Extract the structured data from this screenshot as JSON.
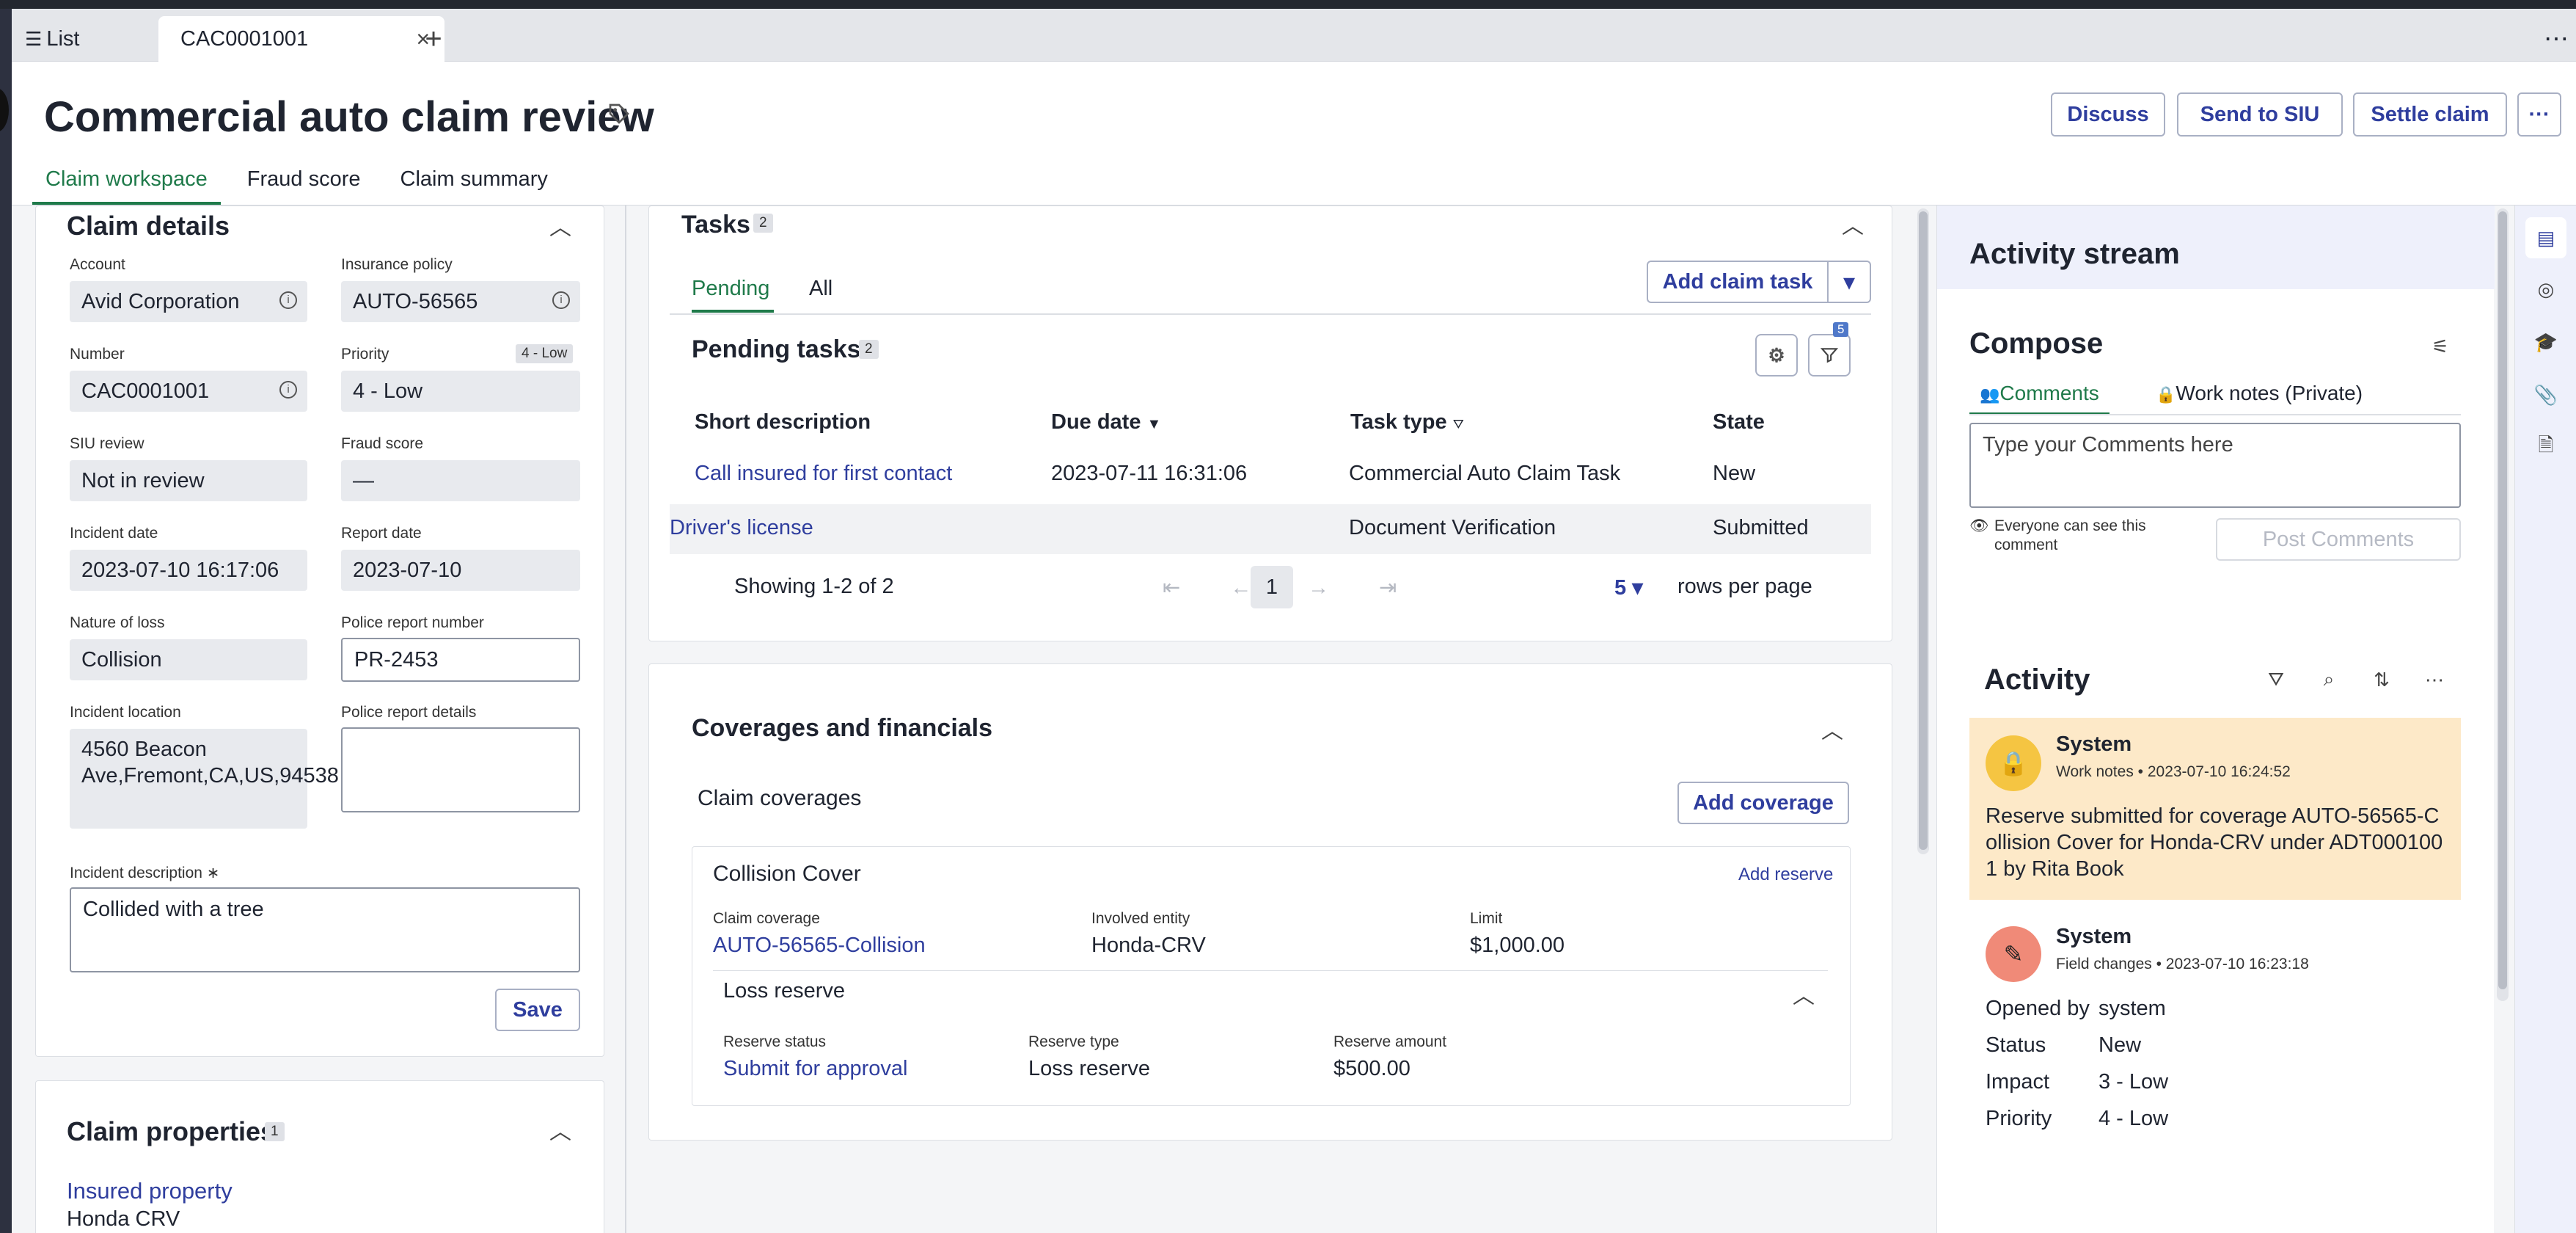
{
  "tabs": {
    "list_label": "List",
    "active_label": "CAC0001001"
  },
  "header": {
    "title": "Commercial auto claim review",
    "buttons": {
      "discuss": "Discuss",
      "send_siu": "Send to SIU",
      "settle": "Settle claim"
    },
    "subtabs": [
      "Claim workspace",
      "Fraud score",
      "Claim summary"
    ]
  },
  "claim_details": {
    "title": "Claim details",
    "account_label": "Account",
    "account": "Avid Corporation",
    "policy_label": "Insurance policy",
    "policy": "AUTO-56565",
    "number_label": "Number",
    "number": "CAC0001001",
    "priority_label": "Priority",
    "priority": "4 - Low",
    "priority_badge": "4 - Low",
    "siu_label": "SIU review",
    "siu": "Not in review",
    "fraud_label": "Fraud score",
    "fraud": "—",
    "incident_date_label": "Incident date",
    "incident_date": "2023-07-10 16:17:06",
    "report_date_label": "Report date",
    "report_date": "2023-07-10",
    "nature_label": "Nature of loss",
    "nature": "Collision",
    "police_num_label": "Police report number",
    "police_num": "PR-2453",
    "location_label": "Incident location",
    "location": "4560 Beacon Ave,Fremont,CA,US,94538",
    "police_details_label": "Police report details",
    "description_label": "Incident description",
    "required_mark": "∗",
    "description": "Collided with a tree",
    "save": "Save"
  },
  "claim_properties": {
    "title": "Claim properties",
    "count": "1",
    "insured_label": "Insured property",
    "insured_value": "Honda CRV"
  },
  "tasks": {
    "title": "Tasks",
    "count": "2",
    "tab_pending": "Pending",
    "tab_all": "All",
    "add_task": "Add claim task",
    "pending_title": "Pending tasks",
    "pending_count": "2",
    "filter_badge": "5",
    "columns": [
      "Short description",
      "Due date",
      "Task type",
      "State"
    ],
    "rows": [
      {
        "desc": "Call insured for first contact",
        "due": "2023-07-11 16:31:06",
        "type": "Commercial Auto Claim Task",
        "state": "New"
      },
      {
        "desc": "Driver's license",
        "due": "",
        "type": "Document Verification",
        "state": "Submitted"
      }
    ],
    "showing": "Showing 1-2 of 2",
    "page": "1",
    "rows_per_page_value": "5",
    "rows_per_page": "rows per page"
  },
  "coverages": {
    "title": "Coverages and financials",
    "claim_coverages": "Claim coverages",
    "add_coverage": "Add coverage",
    "cover_title": "Collision Cover",
    "add_reserve": "Add reserve",
    "coverage_label": "Claim coverage",
    "coverage_value": "AUTO-56565-Collision",
    "entity_label": "Involved entity",
    "entity_value": "Honda-CRV",
    "limit_label": "Limit",
    "limit_value": "$1,000.00",
    "loss_reserve_title": "Loss reserve",
    "status_label": "Reserve status",
    "status_value": "Submit for approval",
    "type_label": "Reserve type",
    "type_value": "Loss reserve",
    "amount_label": "Reserve amount",
    "amount_value": "$500.00"
  },
  "activity_stream": {
    "title": "Activity stream",
    "compose": "Compose",
    "tab_comments": "Comments",
    "tab_worknotes": "Work notes (Private)",
    "placeholder": "Type your Comments here",
    "visibility": "Everyone can see this comment",
    "post": "Post Comments",
    "activity_title": "Activity",
    "entries": [
      {
        "author": "System",
        "meta": "Work notes • 2023-07-10 16:24:52",
        "body": "Reserve submitted for coverage AUTO-56565-Collision Cover for Honda-CRV under ADT0001001 by Rita Book"
      },
      {
        "author": "System",
        "meta": "Field changes • 2023-07-10 16:23:18"
      }
    ],
    "fields": [
      {
        "k": "Opened by",
        "v": "system"
      },
      {
        "k": "Status",
        "v": "New"
      },
      {
        "k": "Impact",
        "v": "3 - Low"
      },
      {
        "k": "Priority",
        "v": "4 - Low"
      }
    ]
  }
}
